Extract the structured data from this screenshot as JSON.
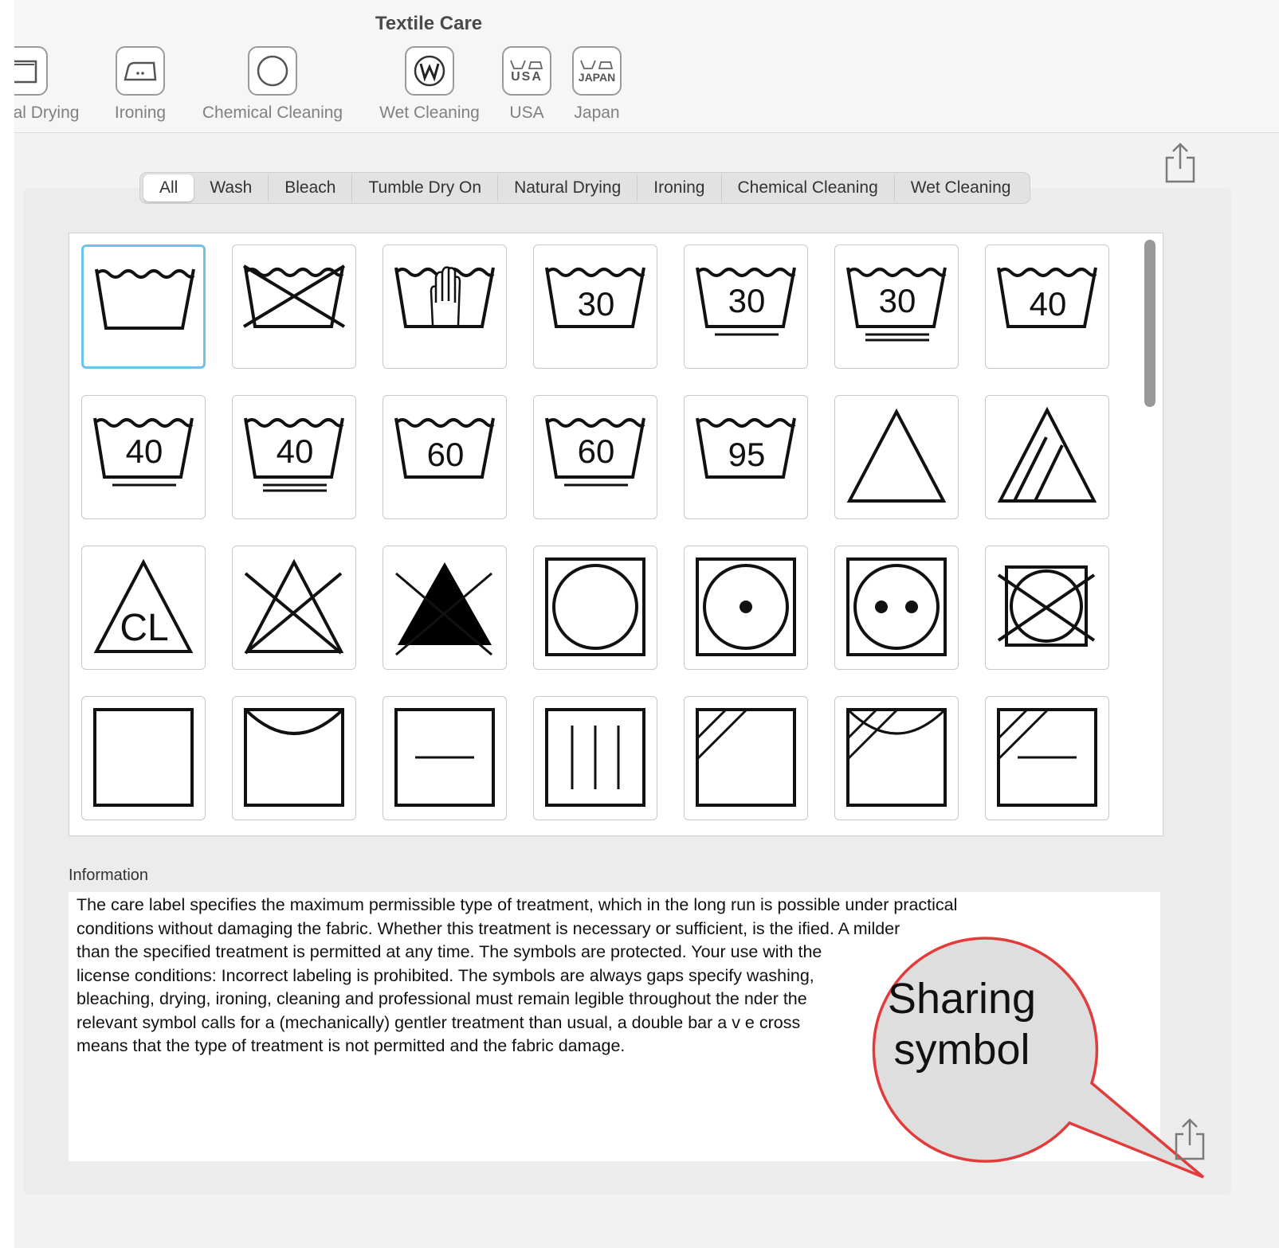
{
  "window": {
    "title": "Textile Care"
  },
  "toolbar": {
    "items": [
      {
        "label": "al Drying",
        "icon": "natural-drying-icon"
      },
      {
        "label": "Ironing",
        "icon": "iron-icon"
      },
      {
        "label": "Chemical Cleaning",
        "icon": "circle-icon"
      },
      {
        "label": "Wet Cleaning",
        "icon": "circled-w-icon"
      },
      {
        "label": "USA",
        "icon": "usa-icon",
        "icon_text": "USA"
      },
      {
        "label": "Japan",
        "icon": "japan-icon",
        "icon_text": "JAPAN"
      }
    ],
    "share_icon": "share-icon"
  },
  "filters": {
    "tabs": [
      "All",
      "Wash",
      "Bleach",
      "Tumble Dry On",
      "Natural Drying",
      "Ironing",
      "Chemical Cleaning",
      "Wet Cleaning"
    ],
    "selected": "All"
  },
  "symbols": [
    {
      "type": "wash"
    },
    {
      "type": "wash-crossed"
    },
    {
      "type": "hand-wash"
    },
    {
      "type": "wash-temp",
      "temp": "30",
      "bars": 0
    },
    {
      "type": "wash-temp",
      "temp": "30",
      "bars": 1
    },
    {
      "type": "wash-temp",
      "temp": "30",
      "bars": 2
    },
    {
      "type": "wash-temp",
      "temp": "40",
      "bars": 0
    },
    {
      "type": "wash-temp",
      "temp": "40",
      "bars": 1
    },
    {
      "type": "wash-temp",
      "temp": "40",
      "bars": 2
    },
    {
      "type": "wash-temp",
      "temp": "60",
      "bars": 0
    },
    {
      "type": "wash-temp",
      "temp": "60",
      "bars": 1
    },
    {
      "type": "wash-temp",
      "temp": "95",
      "bars": 0
    },
    {
      "type": "bleach"
    },
    {
      "type": "bleach-oxygen"
    },
    {
      "type": "bleach-cl",
      "text": "CL"
    },
    {
      "type": "bleach-crossed"
    },
    {
      "type": "bleach-crossed-filled"
    },
    {
      "type": "tumble"
    },
    {
      "type": "tumble-dots",
      "dots": 1
    },
    {
      "type": "tumble-dots",
      "dots": 2
    },
    {
      "type": "tumble-crossed"
    },
    {
      "type": "dry"
    },
    {
      "type": "dry-line"
    },
    {
      "type": "dry-flat"
    },
    {
      "type": "dry-drip"
    },
    {
      "type": "dry-shade"
    },
    {
      "type": "dry-shade-line"
    },
    {
      "type": "dry-shade-flat"
    }
  ],
  "selected_symbol": 0,
  "information": {
    "label": "Information",
    "text": "The care label specifies the maximum permissible type of treatment, which in the long run is possible under practical\nconditions without damaging the fabric. Whether this treatment is necessary or sufficient, is the                        ified. A milder\nthan the specified treatment is permitted at any time. The symbols are protected. Your use                               with the\nlicense conditions: Incorrect labeling is prohibited. The symbols are always gaps specify                                  washing,\nbleaching, drying, ironing, cleaning and professional must remain legible throughout the                                 nder the\nrelevant symbol calls for a (mechanically) gentler treatment than usual, a double bar a v                                 e cross\nmeans that the type of treatment is not permitted and the fabric damage."
  },
  "callout": {
    "text_line1": "Sharing",
    "text_line2": "symbol",
    "border_color": "#e23b3b",
    "fill_color": "#dedede"
  },
  "colors": {
    "selection": "#6ec1ef",
    "accent_red": "#e23b3b"
  }
}
